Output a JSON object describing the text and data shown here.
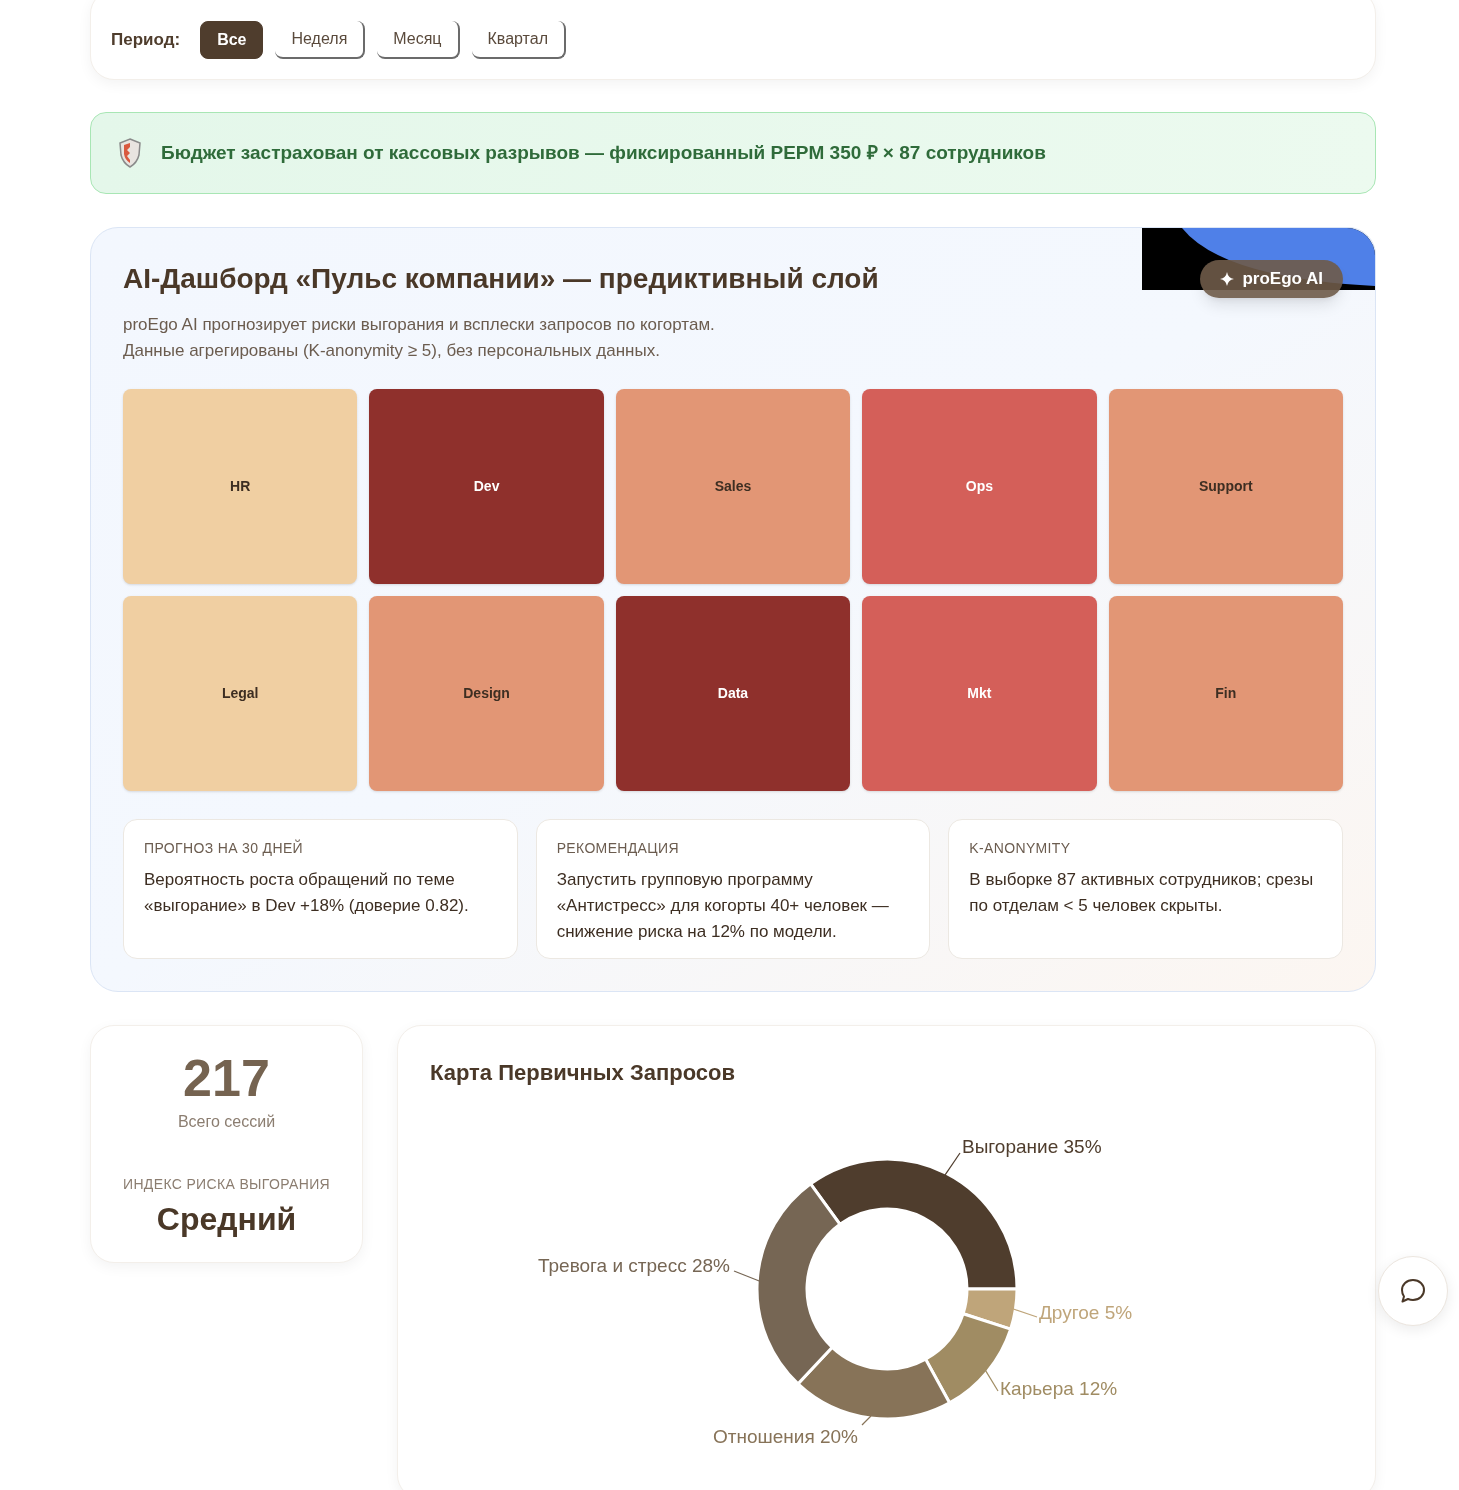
{
  "period_filter": {
    "label": "Период:",
    "options": [
      {
        "label": "Все",
        "selected": true
      },
      {
        "label": "Неделя",
        "selected": false
      },
      {
        "label": "Месяц",
        "selected": false
      },
      {
        "label": "Квартал",
        "selected": false
      }
    ]
  },
  "banner": {
    "text": "Бюджет застрахован от кассовых разрывов — фиксированный PEPM 350 ₽ × 87 сотрудников"
  },
  "ai_dashboard": {
    "title": "AI-Дашборд «Пульс компании» — предиктивный слой",
    "badge": "proEgo AI",
    "description": [
      "proEgo AI прогнозирует риски выгорания и всплески запросов по когортам.",
      "Данные агрегированы (K-anonymity ≥ 5), без персональных данных."
    ],
    "heatmap": [
      {
        "label": "HR",
        "color": "#f0cfa2"
      },
      {
        "label": "Dev",
        "color": "#8f302c"
      },
      {
        "label": "Sales",
        "color": "#e29675"
      },
      {
        "label": "Ops",
        "color": "#d45f59"
      },
      {
        "label": "Support",
        "color": "#e29675"
      },
      {
        "label": "Legal",
        "color": "#f0cfa2"
      },
      {
        "label": "Design",
        "color": "#e29675"
      },
      {
        "label": "Data",
        "color": "#8f302c"
      },
      {
        "label": "Mkt",
        "color": "#d45f59"
      },
      {
        "label": "Fin",
        "color": "#e29675"
      }
    ],
    "insights": [
      {
        "heading": "ПРОГНОЗ НА 30 ДНЕЙ",
        "text": "Вероятность роста обращений по теме «выгорание» в Dev +18% (доверие 0.82)."
      },
      {
        "heading": "РЕКОМЕНДАЦИЯ",
        "text": "Запустить групповую программу «Антистресс» для когорты 40+ человек — снижение риска на 12% по модели."
      },
      {
        "heading": "K-ANONYMITY",
        "text": "В выборке 87 активных сотрудников; срезы по отделам < 5 человек скрыты."
      }
    ]
  },
  "sessions_card": {
    "value": "217",
    "label": "Всего сессий",
    "risk_label": "ИНДЕКС РИСКА ВЫГОРАНИЯ",
    "risk_value": "Средний"
  },
  "requests_map": {
    "title": "Карта Первичных Запросов",
    "chart_data": {
      "type": "donut",
      "categories": [
        "Выгорание 35%",
        "Другое 5%",
        "Карьера 12%",
        "Отношения 20%",
        "Тревога и стресс 28%"
      ],
      "values": [
        35,
        5,
        12,
        20,
        28
      ],
      "colors": [
        "#4f3d2d",
        "#bfa57a",
        "#a08c63",
        "#877358",
        "#766654"
      ]
    }
  }
}
